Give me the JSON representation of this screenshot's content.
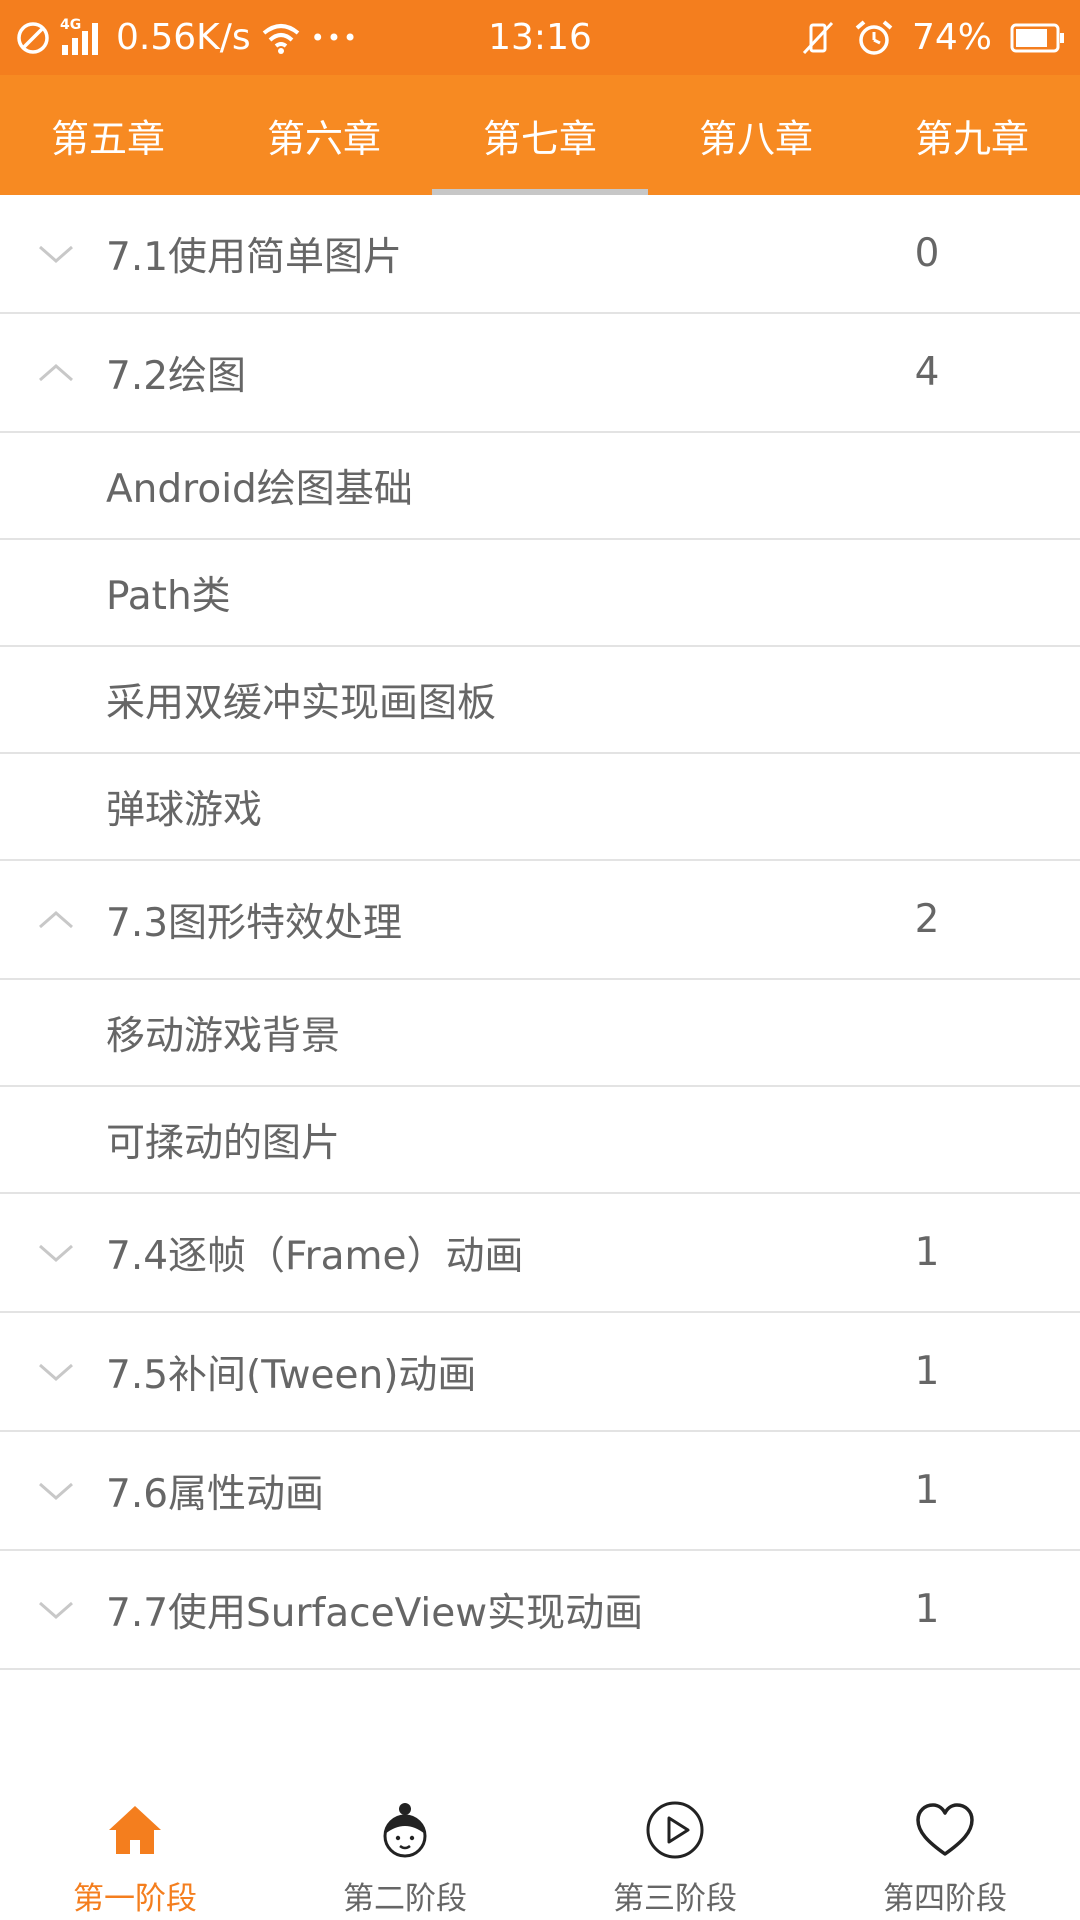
{
  "status_bar": {
    "network_type": "4G",
    "speed": "0.56K/s",
    "more": "•••",
    "time": "13:16",
    "battery": "74%",
    "icons": [
      "blocked-icon",
      "signal-icon",
      "wifi-icon",
      "vibrate-off-icon",
      "alarm-icon",
      "battery-icon"
    ]
  },
  "tabs": [
    {
      "label": "第五章"
    },
    {
      "label": "第六章"
    },
    {
      "label": "第七章",
      "selected": true
    },
    {
      "label": "第八章"
    },
    {
      "label": "第九章"
    }
  ],
  "list": {
    "rows": [
      {
        "type": "group",
        "label": "7.1使用简单图片",
        "count": "0",
        "expanded": false
      },
      {
        "type": "group",
        "label": "7.2绘图",
        "count": "4",
        "expanded": true
      },
      {
        "type": "child",
        "label": "Android绘图基础"
      },
      {
        "type": "child",
        "label": "Path类"
      },
      {
        "type": "child",
        "label": "采用双缓冲实现画图板"
      },
      {
        "type": "child",
        "label": "弹球游戏"
      },
      {
        "type": "group",
        "label": "7.3图形特效处理",
        "count": "2",
        "expanded": true
      },
      {
        "type": "child",
        "label": "移动游戏背景"
      },
      {
        "type": "child",
        "label": "可揉动的图片"
      },
      {
        "type": "group",
        "label": "7.4逐帧（Frame）动画",
        "count": "1",
        "expanded": false
      },
      {
        "type": "group",
        "label": "7.5补间(Tween)动画",
        "count": "1",
        "expanded": false
      },
      {
        "type": "group",
        "label": "7.6属性动画",
        "count": "1",
        "expanded": false
      },
      {
        "type": "group",
        "label": "7.7使用SurfaceView实现动画",
        "count": "1",
        "expanded": false
      }
    ]
  },
  "bottom_nav": [
    {
      "label": "第一阶段",
      "icon": "home-icon",
      "active": true
    },
    {
      "label": "第二阶段",
      "icon": "girl-face-icon",
      "active": false
    },
    {
      "label": "第三阶段",
      "icon": "play-circle-icon",
      "active": false
    },
    {
      "label": "第四阶段",
      "icon": "heart-icon",
      "active": false
    }
  ],
  "colors": {
    "status_bar": "#f47e1e",
    "tab_bar": "#f78a22",
    "tab_indicator": "#c7c7c7",
    "accent": "#f47e1e",
    "text": "#666666",
    "divider": "#e3e3e3"
  }
}
